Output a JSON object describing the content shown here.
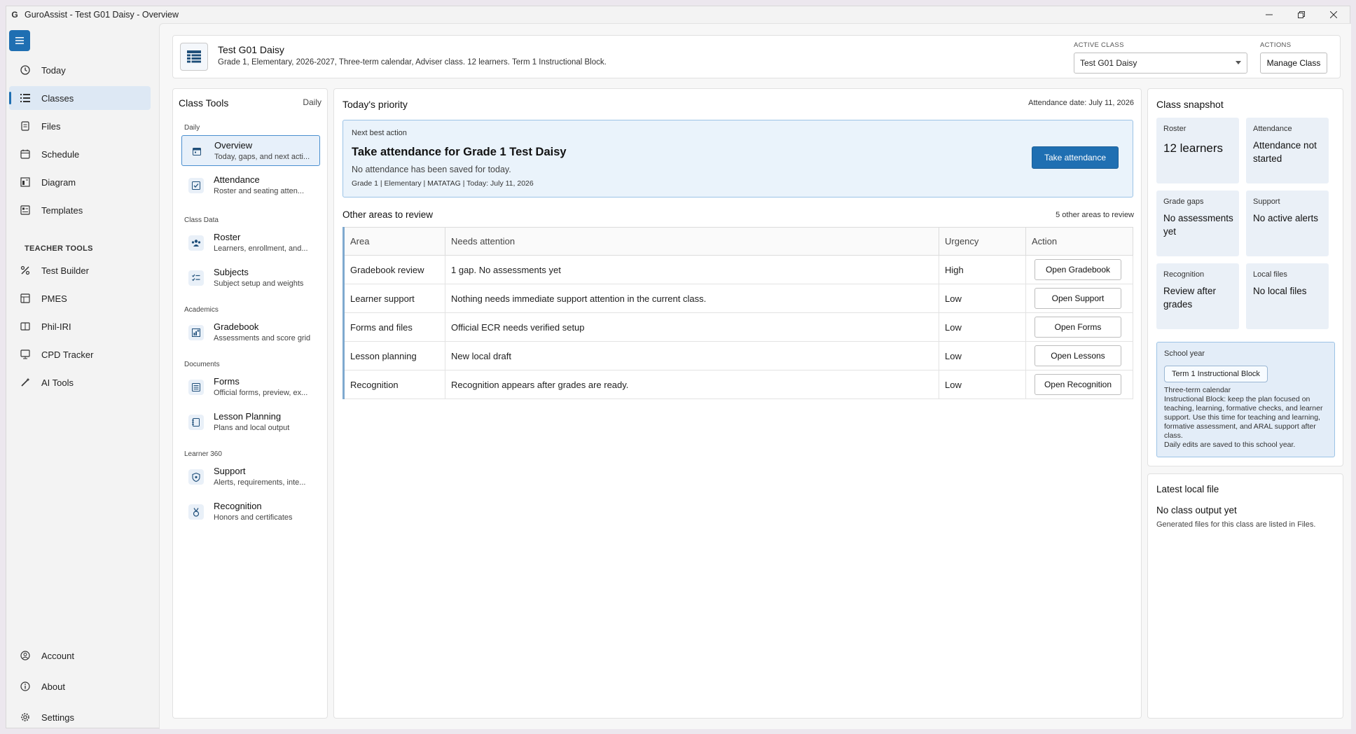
{
  "window": {
    "title": "GuroAssist - Test G01 Daisy - Overview",
    "app_icon": "guroassist-logo"
  },
  "nav": {
    "items": [
      {
        "label": "Today",
        "icon": "clock-icon"
      },
      {
        "label": "Classes",
        "icon": "list-icon"
      },
      {
        "label": "Files",
        "icon": "files-icon"
      },
      {
        "label": "Schedule",
        "icon": "calendar-icon"
      },
      {
        "label": "Diagram",
        "icon": "diagram-icon"
      },
      {
        "label": "Templates",
        "icon": "templates-icon"
      }
    ],
    "teacher_tools_label": "TEACHER TOOLS",
    "tools": [
      {
        "label": "Test Builder"
      },
      {
        "label": "PMES"
      },
      {
        "label": "Phil-IRI"
      },
      {
        "label": "CPD Tracker"
      },
      {
        "label": "AI Tools"
      }
    ],
    "bottom": [
      {
        "label": "Account"
      },
      {
        "label": "About"
      },
      {
        "label": "Settings"
      }
    ]
  },
  "header": {
    "title": "Test G01 Daisy",
    "subtitle": "Grade 1, Elementary, 2026-2027, Three-term calendar, Adviser class. 12 learners. Term 1 Instructional Block.",
    "active_class_label": "ACTIVE CLASS",
    "active_class_value": "Test G01 Daisy",
    "actions_label": "ACTIONS",
    "manage_class": "Manage Class"
  },
  "class_tools": {
    "title": "Class Tools",
    "mode": "Daily",
    "sections": {
      "daily": "Daily",
      "class_data": "Class Data",
      "academics": "Academics",
      "documents": "Documents",
      "learner360": "Learner 360"
    },
    "items": {
      "overview": {
        "title": "Overview",
        "sub": "Today, gaps, and next acti..."
      },
      "attendance": {
        "title": "Attendance",
        "sub": "Roster and seating atten..."
      },
      "roster": {
        "title": "Roster",
        "sub": "Learners, enrollment, and..."
      },
      "subjects": {
        "title": "Subjects",
        "sub": "Subject setup and weights"
      },
      "gradebook": {
        "title": "Gradebook",
        "sub": "Assessments and score grid"
      },
      "forms": {
        "title": "Forms",
        "sub": "Official forms, preview, ex..."
      },
      "lesson_planning": {
        "title": "Lesson Planning",
        "sub": "Plans and local output"
      },
      "support": {
        "title": "Support",
        "sub": "Alerts, requirements, inte..."
      },
      "recognition": {
        "title": "Recognition",
        "sub": "Honors and certificates"
      }
    }
  },
  "priority": {
    "title": "Today's priority",
    "attendance_date": "Attendance date: July 11, 2026",
    "next_best_label": "Next best action",
    "headline": "Take attendance for Grade 1 Test Daisy",
    "detail": "No attendance has been saved for today.",
    "meta": "Grade 1 | Elementary | MATATAG | Today: July 11, 2026",
    "button": "Take attendance"
  },
  "review": {
    "title": "Other areas to review",
    "count": "5 other areas to review",
    "columns": [
      "Area",
      "Needs attention",
      "Urgency",
      "Action"
    ],
    "rows": [
      {
        "area": "Gradebook review",
        "needs": "1 gap. No assessments yet",
        "urgency": "High",
        "action": "Open Gradebook"
      },
      {
        "area": "Learner support",
        "needs": "Nothing needs immediate support attention in the current class.",
        "urgency": "Low",
        "action": "Open Support"
      },
      {
        "area": "Forms and files",
        "needs": "Official ECR needs verified setup",
        "urgency": "Low",
        "action": "Open Forms"
      },
      {
        "area": "Lesson planning",
        "needs": "New local draft",
        "urgency": "Low",
        "action": "Open Lessons"
      },
      {
        "area": "Recognition",
        "needs": "Recognition appears after grades are ready.",
        "urgency": "Low",
        "action": "Open Recognition"
      }
    ]
  },
  "snapshot": {
    "title": "Class snapshot",
    "tiles": {
      "roster": {
        "k": "Roster",
        "v": "12 learners"
      },
      "attendance": {
        "k": "Attendance",
        "v": "Attendance not started"
      },
      "grade_gaps": {
        "k": "Grade gaps",
        "v": "No assessments yet"
      },
      "support": {
        "k": "Support",
        "v": "No active alerts"
      },
      "recognition": {
        "k": "Recognition",
        "v": "Review after grades"
      },
      "local_files": {
        "k": "Local files",
        "v": "No local files"
      }
    },
    "school_year": {
      "k": "School year",
      "chip": "Term 1 Instructional Block",
      "line1": "Three-term calendar",
      "line2": "Instructional Block: keep the plan focused on teaching, learning, formative checks, and learner support. Use this time for teaching and learning, formative assessment, and ARAL support after class.",
      "line3": "Daily edits are saved to this school year."
    }
  },
  "latest_file": {
    "title": "Latest local file",
    "main": "No class output yet",
    "sub": "Generated files for this class are listed in Files."
  },
  "colors": {
    "accent": "#1f6fb2",
    "tile_bg": "#eaf0f7",
    "priority_bg": "#eaf3fb"
  }
}
